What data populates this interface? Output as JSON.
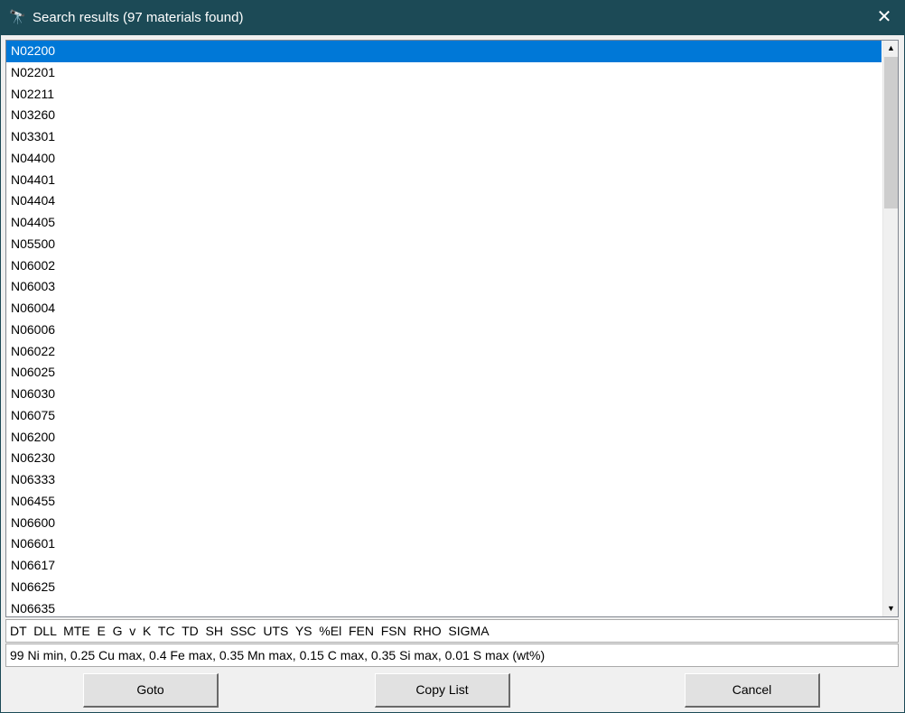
{
  "window": {
    "title": "Search results (97 materials found)",
    "icon": "binoculars-icon",
    "close": "✕"
  },
  "list": {
    "selected_index": 0,
    "items": [
      "N02200",
      "N02201",
      "N02211",
      "N03260",
      "N03301",
      "N04400",
      "N04401",
      "N04404",
      "N04405",
      "N05500",
      "N06002",
      "N06003",
      "N06004",
      "N06006",
      "N06022",
      "N06025",
      "N06030",
      "N06075",
      "N06200",
      "N06230",
      "N06333",
      "N06455",
      "N06600",
      "N06601",
      "N06617",
      "N06625",
      "N06635"
    ]
  },
  "properties_field": "DT  DLL  MTE  E  G  v  K  TC  TD  SH  SSC  UTS  YS  %El  FEN  FSN  RHO  SIGMA",
  "composition_field": "99 Ni min, 0.25 Cu max, 0.4 Fe max, 0.35 Mn max, 0.15 C max, 0.35 Si max, 0.01 S max (wt%)",
  "buttons": {
    "goto": "Goto",
    "copy_list": "Copy List",
    "cancel": "Cancel"
  }
}
